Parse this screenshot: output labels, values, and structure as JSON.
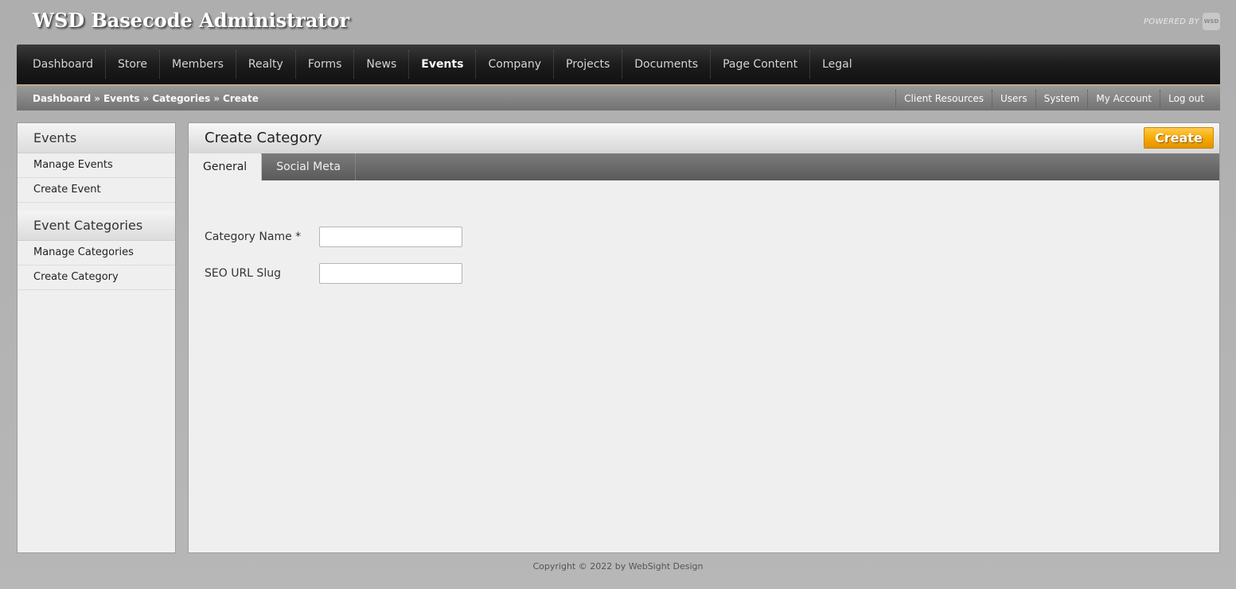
{
  "header": {
    "title": "WSD Basecode Administrator",
    "powered_by": "POWERED BY",
    "logo_text": "WSD"
  },
  "nav": {
    "items": [
      "Dashboard",
      "Store",
      "Members",
      "Realty",
      "Forms",
      "News",
      "Events",
      "Company",
      "Projects",
      "Documents",
      "Page Content",
      "Legal"
    ],
    "active": "Events"
  },
  "breadcrumb": {
    "items": [
      "Dashboard",
      "Events",
      "Categories",
      "Create"
    ],
    "separator": "»"
  },
  "utility_links": [
    "Client Resources",
    "Users",
    "System",
    "My Account",
    "Log out"
  ],
  "sidebar": {
    "sections": [
      {
        "title": "Events",
        "items": [
          "Manage Events",
          "Create Event"
        ]
      },
      {
        "title": "Event Categories",
        "items": [
          "Manage Categories",
          "Create Category"
        ]
      }
    ]
  },
  "content": {
    "title": "Create Category",
    "create_button": "Create",
    "tabs": [
      "General",
      "Social Meta"
    ],
    "active_tab": "General",
    "fields": [
      {
        "label": "Category Name *",
        "value": "",
        "placeholder": ""
      },
      {
        "label": "SEO URL Slug",
        "value": "",
        "placeholder": ""
      }
    ]
  },
  "footer": {
    "copyright": "Copyright © 2022 by WebSight Design"
  },
  "colors": {
    "accent": "#f5a800",
    "nav_bg": "#1c1c1c",
    "nav_border": "#c9a46a"
  }
}
